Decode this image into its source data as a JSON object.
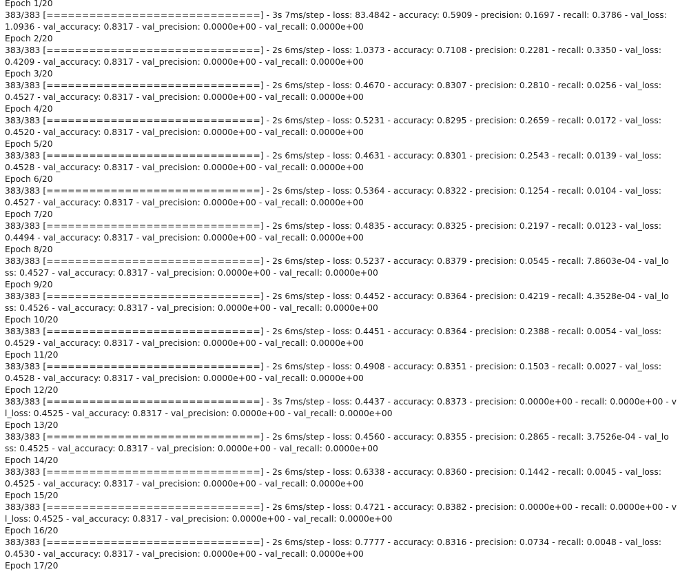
{
  "output": {
    "epochs": [
      {
        "header": "Epoch 1/20",
        "line1": "383/383 [==============================] - 3s 7ms/step - loss: 83.4842 - accuracy: 0.5909 - precision: 0.1697 - recall: 0.3786 - val_loss:",
        "line2": "1.0936 - val_accuracy: 0.8317 - val_precision: 0.0000e+00 - val_recall: 0.0000e+00"
      },
      {
        "header": "Epoch 2/20",
        "line1": "383/383 [==============================] - 2s 6ms/step - loss: 1.0373 - accuracy: 0.7108 - precision: 0.2281 - recall: 0.3350 - val_loss:",
        "line2": "0.4209 - val_accuracy: 0.8317 - val_precision: 0.0000e+00 - val_recall: 0.0000e+00"
      },
      {
        "header": "Epoch 3/20",
        "line1": "383/383 [==============================] - 2s 6ms/step - loss: 0.4670 - accuracy: 0.8307 - precision: 0.2810 - recall: 0.0256 - val_loss:",
        "line2": "0.4527 - val_accuracy: 0.8317 - val_precision: 0.0000e+00 - val_recall: 0.0000e+00"
      },
      {
        "header": "Epoch 4/20",
        "line1": "383/383 [==============================] - 2s 6ms/step - loss: 0.5231 - accuracy: 0.8295 - precision: 0.2659 - recall: 0.0172 - val_loss:",
        "line2": "0.4520 - val_accuracy: 0.8317 - val_precision: 0.0000e+00 - val_recall: 0.0000e+00"
      },
      {
        "header": "Epoch 5/20",
        "line1": "383/383 [==============================] - 2s 6ms/step - loss: 0.4631 - accuracy: 0.8301 - precision: 0.2543 - recall: 0.0139 - val_loss:",
        "line2": "0.4528 - val_accuracy: 0.8317 - val_precision: 0.0000e+00 - val_recall: 0.0000e+00"
      },
      {
        "header": "Epoch 6/20",
        "line1": "383/383 [==============================] - 2s 6ms/step - loss: 0.5364 - accuracy: 0.8322 - precision: 0.1254 - recall: 0.0104 - val_loss:",
        "line2": "0.4527 - val_accuracy: 0.8317 - val_precision: 0.0000e+00 - val_recall: 0.0000e+00"
      },
      {
        "header": "Epoch 7/20",
        "line1": "383/383 [==============================] - 2s 6ms/step - loss: 0.4835 - accuracy: 0.8325 - precision: 0.2197 - recall: 0.0123 - val_loss:",
        "line2": "0.4494 - val_accuracy: 0.8317 - val_precision: 0.0000e+00 - val_recall: 0.0000e+00"
      },
      {
        "header": "Epoch 8/20",
        "line1": "383/383 [==============================] - 2s 6ms/step - loss: 0.5237 - accuracy: 0.8379 - precision: 0.0545 - recall: 7.8603e-04 - val_lo",
        "line2": "ss: 0.4527 - val_accuracy: 0.8317 - val_precision: 0.0000e+00 - val_recall: 0.0000e+00"
      },
      {
        "header": "Epoch 9/20",
        "line1": "383/383 [==============================] - 2s 6ms/step - loss: 0.4452 - accuracy: 0.8364 - precision: 0.4219 - recall: 4.3528e-04 - val_lo",
        "line2": "ss: 0.4526 - val_accuracy: 0.8317 - val_precision: 0.0000e+00 - val_recall: 0.0000e+00"
      },
      {
        "header": "Epoch 10/20",
        "line1": "383/383 [==============================] - 2s 6ms/step - loss: 0.4451 - accuracy: 0.8364 - precision: 0.2388 - recall: 0.0054 - val_loss:",
        "line2": "0.4529 - val_accuracy: 0.8317 - val_precision: 0.0000e+00 - val_recall: 0.0000e+00"
      },
      {
        "header": "Epoch 11/20",
        "line1": "383/383 [==============================] - 2s 6ms/step - loss: 0.4908 - accuracy: 0.8351 - precision: 0.1503 - recall: 0.0027 - val_loss:",
        "line2": "0.4528 - val_accuracy: 0.8317 - val_precision: 0.0000e+00 - val_recall: 0.0000e+00"
      },
      {
        "header": "Epoch 12/20",
        "line1": "383/383 [==============================] - 3s 7ms/step - loss: 0.4437 - accuracy: 0.8373 - precision: 0.0000e+00 - recall: 0.0000e+00 - va",
        "line2": "l_loss: 0.4525 - val_accuracy: 0.8317 - val_precision: 0.0000e+00 - val_recall: 0.0000e+00"
      },
      {
        "header": "Epoch 13/20",
        "line1": "383/383 [==============================] - 2s 6ms/step - loss: 0.4560 - accuracy: 0.8355 - precision: 0.2865 - recall: 3.7526e-04 - val_lo",
        "line2": "ss: 0.4525 - val_accuracy: 0.8317 - val_precision: 0.0000e+00 - val_recall: 0.0000e+00"
      },
      {
        "header": "Epoch 14/20",
        "line1": "383/383 [==============================] - 2s 6ms/step - loss: 0.6338 - accuracy: 0.8360 - precision: 0.1442 - recall: 0.0045 - val_loss:",
        "line2": "0.4525 - val_accuracy: 0.8317 - val_precision: 0.0000e+00 - val_recall: 0.0000e+00"
      },
      {
        "header": "Epoch 15/20",
        "line1": "383/383 [==============================] - 2s 6ms/step - loss: 0.4721 - accuracy: 0.8382 - precision: 0.0000e+00 - recall: 0.0000e+00 - va",
        "line2": "l_loss: 0.4525 - val_accuracy: 0.8317 - val_precision: 0.0000e+00 - val_recall: 0.0000e+00"
      },
      {
        "header": "Epoch 16/20",
        "line1": "383/383 [==============================] - 2s 6ms/step - loss: 0.7777 - accuracy: 0.8316 - precision: 0.0734 - recall: 0.0048 - val_loss:",
        "line2": "0.4530 - val_accuracy: 0.8317 - val_precision: 0.0000e+00 - val_recall: 0.0000e+00"
      }
    ],
    "trailing_header": "Epoch 17/20"
  }
}
